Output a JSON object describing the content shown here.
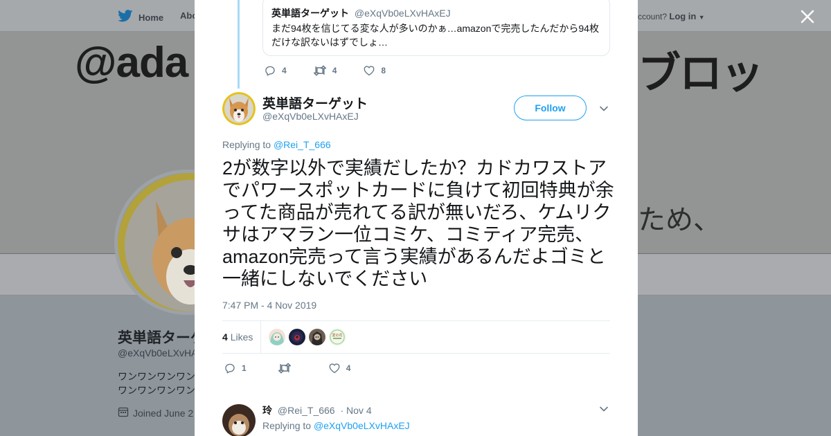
{
  "background": {
    "nav": {
      "home_label": "Home",
      "about_label": "Abo",
      "account_text": "ccount?",
      "login_label": "Log in"
    },
    "banner": {
      "left_text": "@ada",
      "right_text": "ブロッ",
      "right_text_2": "ため、"
    },
    "profile": {
      "name": "英単語ターゲ",
      "handle": "@eXqVb0eLXvHAx",
      "bio_line1": "ワンワンワンワン",
      "bio_line2": "ワンワンワンワン",
      "joined": "Joined June 2"
    }
  },
  "quoted_tweet": {
    "name": "英単語ターゲット",
    "handle": "@eXqVb0eLXvHAxEJ",
    "text": "まだ94枚を信じてる変な人が多いのかぁ…amazonで完売したんだから94枚だけな訳ないはずでしょ…"
  },
  "prev_actions": {
    "replies": "4",
    "retweets": "4",
    "likes": "8"
  },
  "tweet": {
    "author_name": "英単語ターゲット",
    "author_handle": "@eXqVb0eLXvHAxEJ",
    "follow_label": "Follow",
    "replying_prefix": "Replying to",
    "replying_to": "@Rei_T_666",
    "text": "2が数字以外で実績だしたか？カドカワストアでパワースポットカードに負けて初回特典が余ってた商品が売れてる訳が無いだろ、ケムリクサはアマラン一位コミケ、コミティア完売、amazon完売って言う実績があるんだよゴミと一緒にしないでください",
    "timestamp": "7:47 PM - 4 Nov 2019",
    "likes_count": "4",
    "likes_label": "Likes",
    "liker_avatar_4_text": "愛の花"
  },
  "tweet_actions": {
    "replies": "1",
    "retweets": "",
    "likes": "4"
  },
  "reply": {
    "name": "玲",
    "handle": "@Rei_T_666",
    "date": "· Nov 4",
    "replying_prefix": "Replying to",
    "replying_to": "@eXqVb0eLXvHAxEJ"
  },
  "colors": {
    "accent": "#1da1f2",
    "text": "#14171a",
    "muted": "#657786",
    "thread": "#a8daf6",
    "overlay_bg": "#8e959b"
  },
  "icons": [
    "twitter-bird-icon",
    "close-icon",
    "reply-icon",
    "retweet-icon",
    "heart-icon",
    "chevron-down-icon",
    "calendar-icon"
  ]
}
